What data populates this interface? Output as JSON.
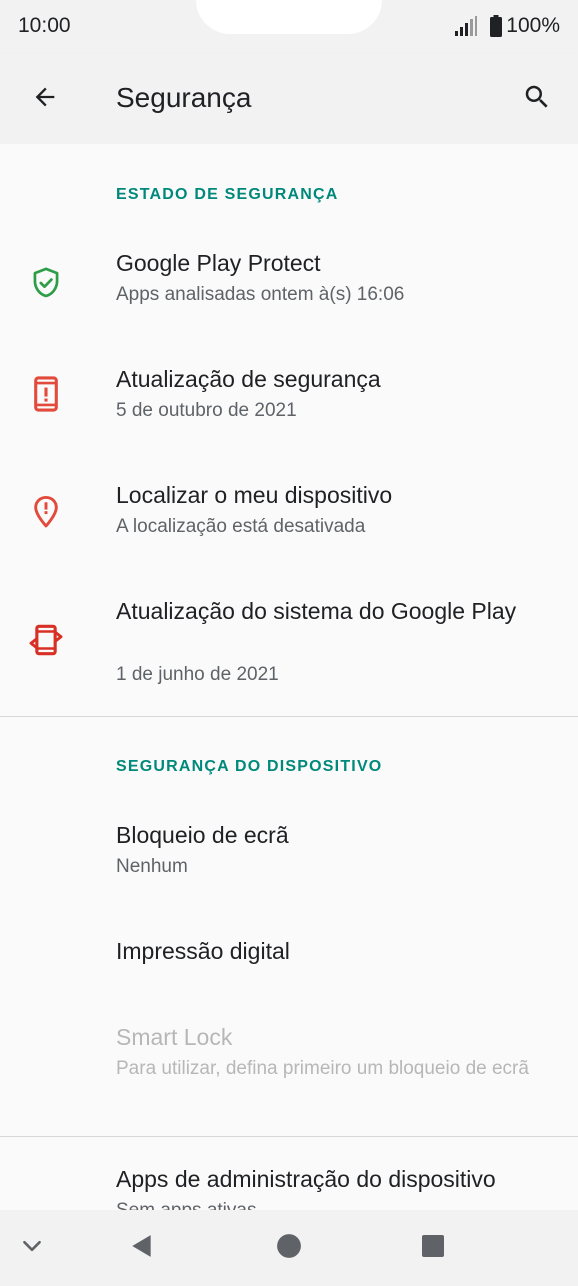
{
  "status_bar": {
    "time": "10:00",
    "battery": "100%"
  },
  "app_bar": {
    "title": "Segurança"
  },
  "sections": {
    "security_status": {
      "header": "ESTADO DE SEGURANÇA",
      "items": [
        {
          "title": "Google Play Protect",
          "subtitle": "Apps analisadas ontem à(s) 16:06",
          "icon": "shield-check-icon",
          "color": "#2e9d47"
        },
        {
          "title": "Atualização de segurança",
          "subtitle": "5 de outubro de 2021",
          "icon": "phone-alert-icon",
          "color": "#e24a3b"
        },
        {
          "title": "Localizar o meu dispositivo",
          "subtitle": "A localização está desativada",
          "icon": "location-alert-icon",
          "color": "#e24a3b"
        },
        {
          "title": "Atualização do sistema do Google Play",
          "subtitle": "1 de junho de 2021",
          "icon": "phone-sync-icon",
          "color": "#d93025"
        }
      ]
    },
    "device_security": {
      "header": "SEGURANÇA DO DISPOSITIVO",
      "items": [
        {
          "title": "Bloqueio de ecrã",
          "subtitle": "Nenhum"
        },
        {
          "title": "Impressão digital"
        },
        {
          "title": "Smart Lock",
          "subtitle": "Para utilizar, defina primeiro um bloqueio de ecrã",
          "disabled": true
        }
      ]
    },
    "admin": {
      "items": [
        {
          "title": "Apps de administração do dispositivo",
          "subtitle": "Sem apps ativas"
        }
      ]
    }
  },
  "colors": {
    "accent": "#00897b",
    "bar_background": "#f2f2f2",
    "content_background": "#fafafa"
  }
}
